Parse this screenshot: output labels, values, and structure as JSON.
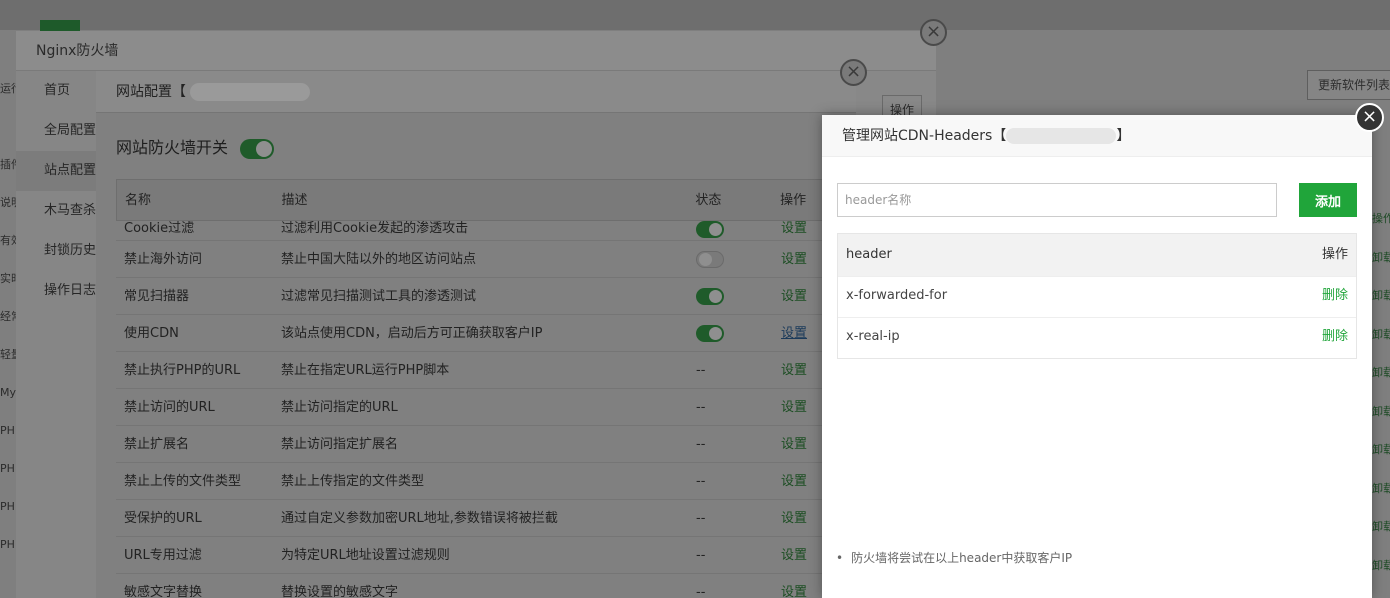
{
  "bg": {
    "update_button": "更新软件列表",
    "left_labels": [
      "运行",
      "",
      "插件",
      "说明",
      "有效",
      "实时",
      "经常",
      "轻量",
      "My",
      "PH",
      "PH",
      "PH",
      "PH"
    ],
    "right_labels": [
      "操作",
      "卸载",
      "卸载",
      "卸载",
      "卸载",
      "卸载",
      "卸载",
      "卸载",
      "卸载",
      "卸载"
    ]
  },
  "nginx_window": {
    "title": "Nginx防火墙",
    "op_button": "操作",
    "nav": [
      "首页",
      "全局配置",
      "站点配置",
      "木马查杀",
      "封锁历史",
      "操作日志"
    ]
  },
  "site_window": {
    "title": "网站配置【",
    "switch_label": "网站防火墙开关",
    "columns": {
      "name": "名称",
      "desc": "描述",
      "status": "状态",
      "op": "操作"
    },
    "rows": [
      {
        "name": "Cookie过滤",
        "desc": "过滤利用Cookie发起的渗透攻击",
        "status": "on",
        "op": "设置"
      },
      {
        "name": "禁止海外访问",
        "desc": "禁止中国大陆以外的地区访问站点",
        "status": "off",
        "op": "设置"
      },
      {
        "name": "常见扫描器",
        "desc": "过滤常见扫描测试工具的渗透测试",
        "status": "on",
        "op": "设置"
      },
      {
        "name": "使用CDN",
        "desc": "该站点使用CDN，启动后方可正确获取客户IP",
        "status": "on",
        "op": "设置"
      },
      {
        "name": "禁止执行PHP的URL",
        "desc": "禁止在指定URL运行PHP脚本",
        "status": "--",
        "op": "设置"
      },
      {
        "name": "禁止访问的URL",
        "desc": "禁止访问指定的URL",
        "status": "--",
        "op": "设置"
      },
      {
        "name": "禁止扩展名",
        "desc": "禁止访问指定扩展名",
        "status": "--",
        "op": "设置"
      },
      {
        "name": "禁止上传的文件类型",
        "desc": "禁止上传指定的文件类型",
        "status": "--",
        "op": "设置"
      },
      {
        "name": "受保护的URL",
        "desc": "通过自定义参数加密URL地址,参数错误将被拦截",
        "status": "--",
        "op": "设置"
      },
      {
        "name": "URL专用过滤",
        "desc": "为特定URL地址设置过滤规则",
        "status": "--",
        "op": "设置"
      },
      {
        "name": "敏感文字替换",
        "desc": "替换设置的敏感文字",
        "status": "--",
        "op": "设置"
      }
    ]
  },
  "cdn_dialog": {
    "title": "管理网站CDN-Headers【",
    "title_end": "】",
    "input_placeholder": "header名称",
    "input_value": "",
    "add_label": "添加",
    "col_header": "header",
    "col_op": "操作",
    "headers": [
      {
        "name": "x-forwarded-for",
        "action": "删除"
      },
      {
        "name": "x-real-ip",
        "action": "删除"
      }
    ],
    "note": "防火墙将尝试在以上header中获取客户IP",
    "accent_color": "#20a53a"
  }
}
